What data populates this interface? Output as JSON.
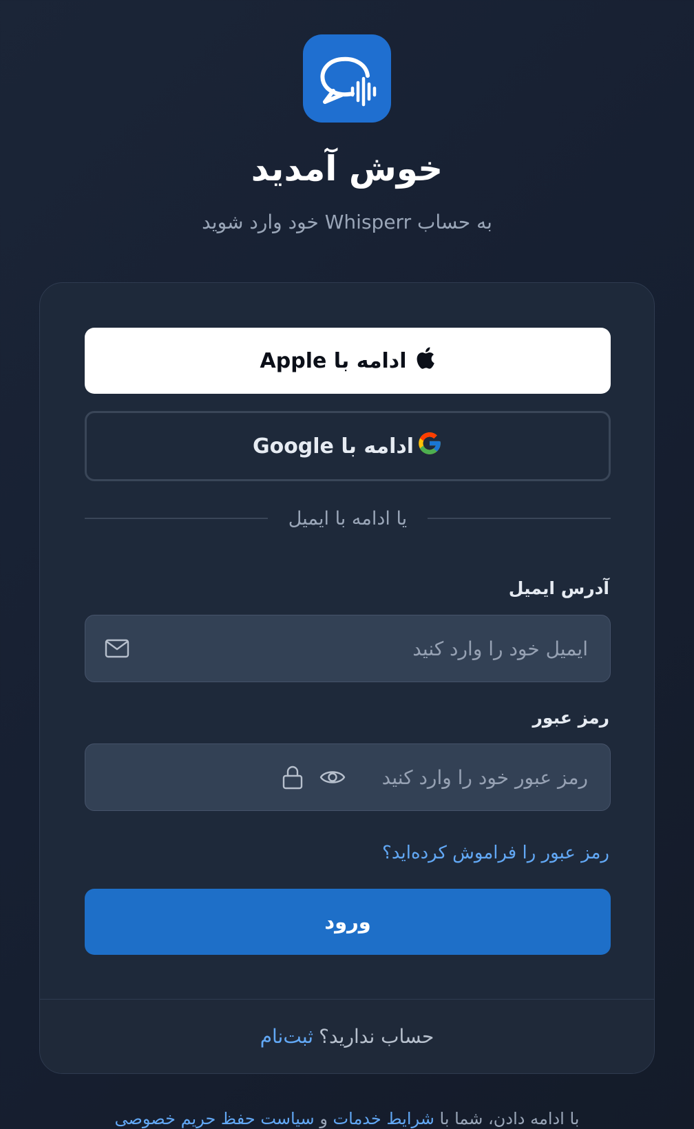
{
  "header": {
    "logo_icon": "chat-bubble-soundwave-icon",
    "title": "خوش آمدید",
    "subtitle": "به حساب Whisperr خود وارد شوید"
  },
  "social": {
    "apple_label": "ادامه با Apple",
    "google_label": "ادامه با Google"
  },
  "divider_text": "یا ادامه با ایمیل",
  "form": {
    "email_label": "آدرس ایمیل",
    "email_placeholder": "ایمیل خود را وارد کنید",
    "email_value": "",
    "password_label": "رمز عبور",
    "password_placeholder": "رمز عبور خود را وارد کنید",
    "password_value": "",
    "forgot_label": "رمز عبور را فراموش کرده‌اید؟",
    "login_label": "ورود"
  },
  "footer": {
    "question": "حساب ندارید؟",
    "signup_label": "ثبت‌نام"
  },
  "terms": {
    "prefix": "با ادامه دادن، شما با",
    "terms_link": "شرایط خدمات",
    "and": "و",
    "privacy_link": "سیاست حفظ حریم خصوصی"
  },
  "colors": {
    "background": "#172032",
    "card": "#1e293a",
    "accent": "#1e6fc8",
    "link": "#62a8f5",
    "input_bg": "#334155"
  }
}
